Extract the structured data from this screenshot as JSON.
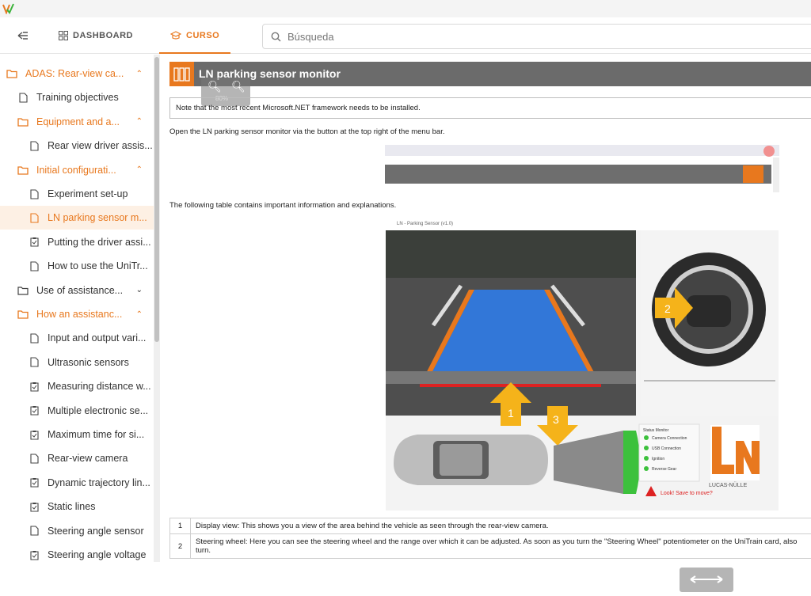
{
  "header": {
    "dashboard_label": "DASHBOARD",
    "curso_label": "CURSO",
    "search_placeholder": "Búsqueda"
  },
  "sidebar": {
    "items": [
      {
        "label": "ADAS: Rear-view ca...",
        "type": "folder",
        "level": 0,
        "chevron": "up"
      },
      {
        "label": "Training objectives",
        "type": "page",
        "level": 1
      },
      {
        "label": "Equipment and a...",
        "type": "folder",
        "level": 1,
        "chevron": "up"
      },
      {
        "label": "Rear view driver assis...",
        "type": "page",
        "level": 2
      },
      {
        "label": "Initial configurati...",
        "type": "folder",
        "level": 1,
        "chevron": "up"
      },
      {
        "label": "Experiment set-up",
        "type": "page",
        "level": 2
      },
      {
        "label": "LN parking sensor m...",
        "type": "page",
        "level": 2,
        "active": true
      },
      {
        "label": "Putting the driver assi...",
        "type": "task",
        "level": 2
      },
      {
        "label": "How to use the UniTr...",
        "type": "page",
        "level": 2
      },
      {
        "label": "Use of assistance...",
        "type": "folder-closed",
        "level": 1,
        "chevron": "down"
      },
      {
        "label": "How an assistanc...",
        "type": "folder",
        "level": 1,
        "chevron": "up"
      },
      {
        "label": "Input and output vari...",
        "type": "page",
        "level": 2
      },
      {
        "label": "Ultrasonic sensors",
        "type": "page",
        "level": 2
      },
      {
        "label": "Measuring distance w...",
        "type": "task",
        "level": 2
      },
      {
        "label": "Multiple electronic se...",
        "type": "task",
        "level": 2
      },
      {
        "label": "Maximum time for si...",
        "type": "task",
        "level": 2
      },
      {
        "label": "Rear-view camera",
        "type": "page",
        "level": 2
      },
      {
        "label": "Dynamic trajectory lin...",
        "type": "task",
        "level": 2
      },
      {
        "label": "Static lines",
        "type": "task",
        "level": 2
      },
      {
        "label": "Steering angle sensor",
        "type": "page",
        "level": 2
      },
      {
        "label": "Steering angle voltage",
        "type": "task",
        "level": 2
      }
    ]
  },
  "content": {
    "title": "LN parking sensor monitor",
    "zoom_label": "80%",
    "note": "Note that the most recent Microsoft.NET framework needs to be installed.",
    "para1": "Open the LN parking sensor monitor via the button at the top right of the menu bar.",
    "para2": "The following table contains important information and explanations.",
    "screenshot": {
      "window_title": "LN - Parking Sensor (v1.0)",
      "arrow_1": "1",
      "arrow_2": "2",
      "arrow_3": "3",
      "status_title": "Status Monitor",
      "status_items": [
        "Camera Connection",
        "USB Connection",
        "Ignition",
        "Reverse Gear"
      ],
      "brand": "LUCAS-NÜLLE",
      "warning": "Look! Save to move?"
    },
    "table": [
      {
        "num": "1",
        "text": "Display view: This shows you a view of the area behind the vehicle as seen through the rear-view camera."
      },
      {
        "num": "2",
        "text": "Steering wheel: Here you can see the steering wheel and the range over which it can be adjusted. As soon as you turn the \"Steering Wheel\" potentiometer on the UniTrain card, also turn."
      }
    ]
  },
  "colors": {
    "accent": "#e8781e",
    "title_bar": "#6b6b6b",
    "active_bg": "#fdf0e4",
    "status_green": "#3cc13c"
  }
}
